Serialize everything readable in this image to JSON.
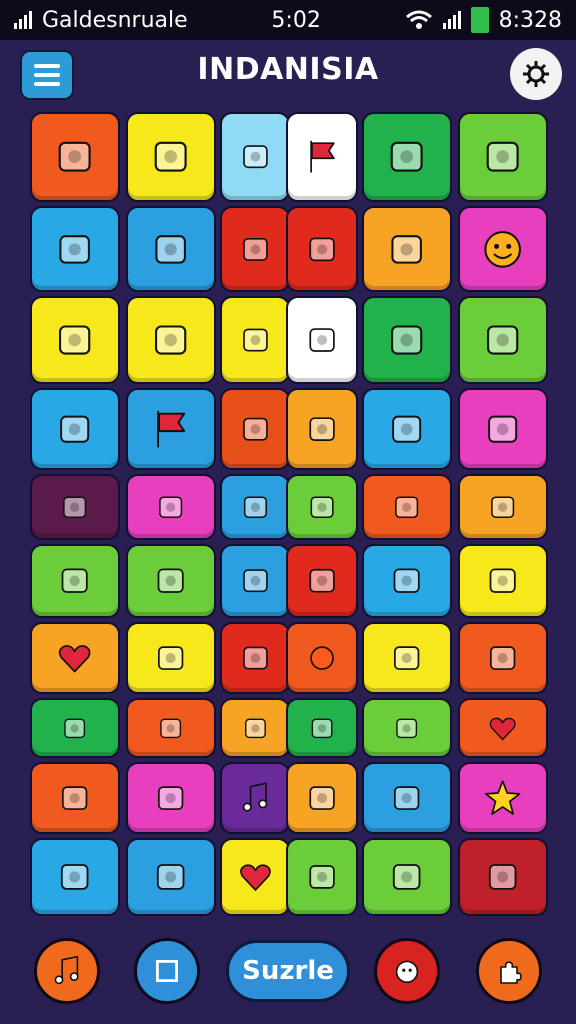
{
  "status_bar": {
    "left_text": "Galdesnruale",
    "time": "5:02",
    "right_time": "8:328"
  },
  "header": {
    "title": "INDANISIA"
  },
  "tiles": [
    {
      "color": "#f05a1e",
      "icon": "stadium-icon"
    },
    {
      "color": "#f6e81a",
      "icon": "popsicle-icon"
    },
    {
      "color": "#8fdaf4",
      "icon": "ice-cream-icon"
    },
    {
      "color": "#ffffff",
      "icon": "flag-icon"
    },
    {
      "color": "#22b24c",
      "icon": "toolbox-icon"
    },
    {
      "color": "#6ccd3a",
      "icon": "rocket-icon"
    },
    {
      "color": "#29a8e6",
      "icon": "lollipop-icon"
    },
    {
      "color": "#2b9fe0",
      "icon": "salad-bowl-icon"
    },
    {
      "color": "#e02a1e",
      "icon": "chili-icon"
    },
    {
      "color": "#e02a1e",
      "icon": "robot-icon"
    },
    {
      "color": "#f7a324",
      "icon": "football-icon"
    },
    {
      "color": "#e83fbf",
      "icon": "smiley-icon"
    },
    {
      "color": "#f6e81a",
      "icon": "battery-icon"
    },
    {
      "color": "#f6e81a",
      "icon": "box-icon"
    },
    {
      "color": "#f6e81a",
      "icon": "lamp-icon"
    },
    {
      "color": "#ffffff",
      "icon": "diamond-icon"
    },
    {
      "color": "#22b24c",
      "icon": "turtle-icon"
    },
    {
      "color": "#6ccd3a",
      "icon": "leaf-icon"
    },
    {
      "color": "#29a8e6",
      "icon": "drum-icon"
    },
    {
      "color": "#2b9fe0",
      "icon": "flag-icon"
    },
    {
      "color": "#e8501a",
      "icon": "phone-icon"
    },
    {
      "color": "#f7a324",
      "icon": "maple-leaf-icon"
    },
    {
      "color": "#29a8e6",
      "icon": "hammer-icon"
    },
    {
      "color": "#e83fbf",
      "icon": "mouth-icon"
    },
    {
      "color": "#5a1a4a",
      "icon": "keyboard-icon"
    },
    {
      "color": "#e83fbf",
      "icon": "ticket-icon"
    },
    {
      "color": "#2b9fe0",
      "icon": "cube-icon"
    },
    {
      "color": "#6ccd3a",
      "icon": "planet-icon"
    },
    {
      "color": "#f05a1e",
      "icon": "strawberry-icon"
    },
    {
      "color": "#f7a324",
      "icon": "chat-bubble-icon"
    },
    {
      "color": "#6ccd3a",
      "icon": "fruit-bowl-icon"
    },
    {
      "color": "#6ccd3a",
      "icon": "mango-icon"
    },
    {
      "color": "#2b9fe0",
      "icon": "map-icon"
    },
    {
      "color": "#e02a1e",
      "icon": "bowl-icon"
    },
    {
      "color": "#29a8e6",
      "icon": "fish-icon"
    },
    {
      "color": "#f6e81a",
      "icon": "gift-box-icon"
    },
    {
      "color": "#f7a324",
      "icon": "heart-icon"
    },
    {
      "color": "#f6e81a",
      "icon": "chart-icon"
    },
    {
      "color": "#e02a1e",
      "icon": "location-pin-icon"
    },
    {
      "color": "#f05a1e",
      "icon": "sun-icon"
    },
    {
      "color": "#f6e81a",
      "icon": "briefcase-icon"
    },
    {
      "color": "#f05a1e",
      "icon": "envelope-icon"
    },
    {
      "color": "#22b24c",
      "icon": "radio-icon"
    },
    {
      "color": "#f05a1e",
      "icon": "maple-leaf-icon"
    },
    {
      "color": "#f7a324",
      "icon": "cat-icon"
    },
    {
      "color": "#22b24c",
      "icon": "pretzel-icon"
    },
    {
      "color": "#6ccd3a",
      "icon": "crown-face-icon"
    },
    {
      "color": "#f05a1e",
      "icon": "heart-icon"
    },
    {
      "color": "#f05a1e",
      "icon": "apple-icon"
    },
    {
      "color": "#e83fbf",
      "icon": "bird-icon"
    },
    {
      "color": "#6a2a9a",
      "icon": "music-note-icon"
    },
    {
      "color": "#f7a324",
      "icon": "bag-icon"
    },
    {
      "color": "#2b9fe0",
      "icon": "salad-bowl-icon"
    },
    {
      "color": "#e83fbf",
      "icon": "star-face-icon"
    },
    {
      "color": "#29a8e6",
      "icon": "rice-bowl-icon"
    },
    {
      "color": "#2b9fe0",
      "icon": "rocket-icon"
    },
    {
      "color": "#f6e81a",
      "icon": "heart-icon"
    },
    {
      "color": "#6ccd3a",
      "icon": "pencil-icon"
    },
    {
      "color": "#6ccd3a",
      "icon": "carrot-icon"
    },
    {
      "color": "#c0202a",
      "icon": "card-icon"
    }
  ],
  "bottom_bar": {
    "center_label": "Suzrle",
    "buttons": [
      {
        "color": "#f06a1e",
        "icon": "music-note-icon"
      },
      {
        "color": "#2f8fd8",
        "icon": "square-icon"
      },
      {
        "color": "#d8231e",
        "icon": "face-icon"
      },
      {
        "color": "#f06a1e",
        "icon": "puzzle-icon"
      }
    ]
  }
}
